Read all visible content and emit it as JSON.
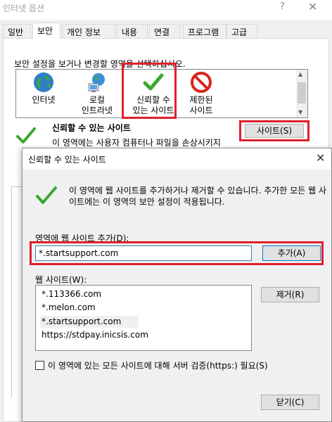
{
  "background_window": {
    "title": "인터넷 옵션",
    "help_glyph": "?",
    "close_glyph": "✕",
    "tabs": [
      {
        "label": "일반"
      },
      {
        "label": "보안",
        "active": true
      },
      {
        "label": "개인 정보"
      },
      {
        "label": "내용"
      },
      {
        "label": "연결"
      },
      {
        "label": "프로그램"
      },
      {
        "label": "고급"
      }
    ],
    "zone_instruction": "보안 설정을 보거나 변경할 영역을 선택하십시오.",
    "zones": [
      {
        "label": "인터넷",
        "icon": "globe-icon"
      },
      {
        "label": "로컬\n인트라넷",
        "icon": "intranet-icon"
      },
      {
        "label": "신뢰할 수\n있는 사이트",
        "icon": "checkmark-icon",
        "highlighted": true
      },
      {
        "label": "제한된\n사이트",
        "icon": "restricted-icon"
      }
    ],
    "selected_zone_title": "신뢰할 수 있는 사이트",
    "selected_zone_desc": "이 영역에는 사용자 컴퓨터나 파일을 손상시키지",
    "sites_button": "사이트(S)"
  },
  "dialog": {
    "title": "신뢰할 수 있는 사이트",
    "close_glyph": "✕",
    "description": "이 영역에 웹 사이트를 추가하거나 제거할 수 있습니다. 추가한 모든 웹 사이트에는 이 영역의 보안 설정이 적용됩니다.",
    "add_label": "영역에 웹 사이트 추가(D):",
    "add_value": "*.startsupport.com",
    "add_button": "추가(A)",
    "sites_label": "웹 사이트(W):",
    "sites": [
      {
        "url": "*.113366.com"
      },
      {
        "url": "*.melon.com"
      },
      {
        "url": "*.startsupport.com",
        "selected": true
      },
      {
        "url": "https://stdpay.inicsis.com"
      }
    ],
    "remove_button": "제거(R)",
    "https_check_label": "이 영역에 있는 모든 사이트에 대해 서버 검증(https:) 필요(S)",
    "https_checked": false,
    "close_button": "닫기(C)"
  },
  "colors": {
    "highlight": "#e0202a",
    "check_green": "#3aa82e",
    "restricted_red": "#d9251d",
    "focus_blue": "#0078d7"
  }
}
